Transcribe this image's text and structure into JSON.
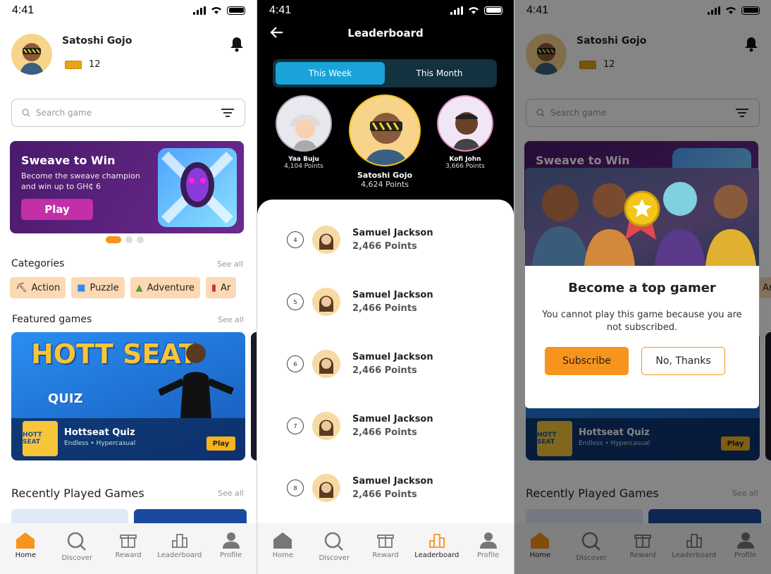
{
  "status": {
    "time": "4:41"
  },
  "user": {
    "name": "Satoshi Gojo",
    "tokens": "12"
  },
  "search": {
    "placeholder": "Search game"
  },
  "banner": {
    "title": "Sweave to Win",
    "description": "Become the sweave champion and win up to GH₵ 6",
    "button": "Play"
  },
  "categories": {
    "title": "Categories",
    "see_all": "See all",
    "items": [
      "Action",
      "Puzzle",
      "Adventure",
      "Ar"
    ]
  },
  "featured": {
    "title": "Featured games",
    "see_all": "See all",
    "logo_line1": "HOTT SEAT",
    "logo_line2": "QUIZ",
    "thumb": "HOTT SEAT",
    "game_name": "Hottseat Quiz",
    "game_genre": "Endless • Hypercasual",
    "play": "Play"
  },
  "recent": {
    "title": "Recently Played Games",
    "see_all": "See all"
  },
  "nav": {
    "home": "Home",
    "discover": "Discover",
    "reward": "Reward",
    "leaderboard": "Leaderboard",
    "profile": "Profile"
  },
  "leaderboard": {
    "title": "Leaderboard",
    "tabs": [
      "This Week",
      "This Month"
    ],
    "podium": [
      {
        "name": "Yaa Buju",
        "points": "4,104 Points"
      },
      {
        "name": "Satoshi Gojo",
        "points": "4,624 Points"
      },
      {
        "name": "Kofi John",
        "points": "3,666 Points"
      }
    ],
    "rows": [
      {
        "rank": "4",
        "name": "Samuel Jackson",
        "points": "2,466 Points"
      },
      {
        "rank": "5",
        "name": "Samuel Jackson",
        "points": "2,466 Points"
      },
      {
        "rank": "6",
        "name": "Samuel Jackson",
        "points": "2,466 Points"
      },
      {
        "rank": "7",
        "name": "Samuel Jackson",
        "points": "2,466 Points"
      },
      {
        "rank": "8",
        "name": "Samuel Jackson",
        "points": "2,466 Points"
      }
    ]
  },
  "modal": {
    "title": "Become a top gamer",
    "description": "You cannot play this game because you are not subscribed.",
    "subscribe": "Subscribe",
    "decline": "No, Thanks"
  },
  "colors": {
    "accent": "#f7941d",
    "tab_active": "#1aa3d9",
    "banner": "#4a1a6b",
    "chip": "#fcd9b4"
  }
}
